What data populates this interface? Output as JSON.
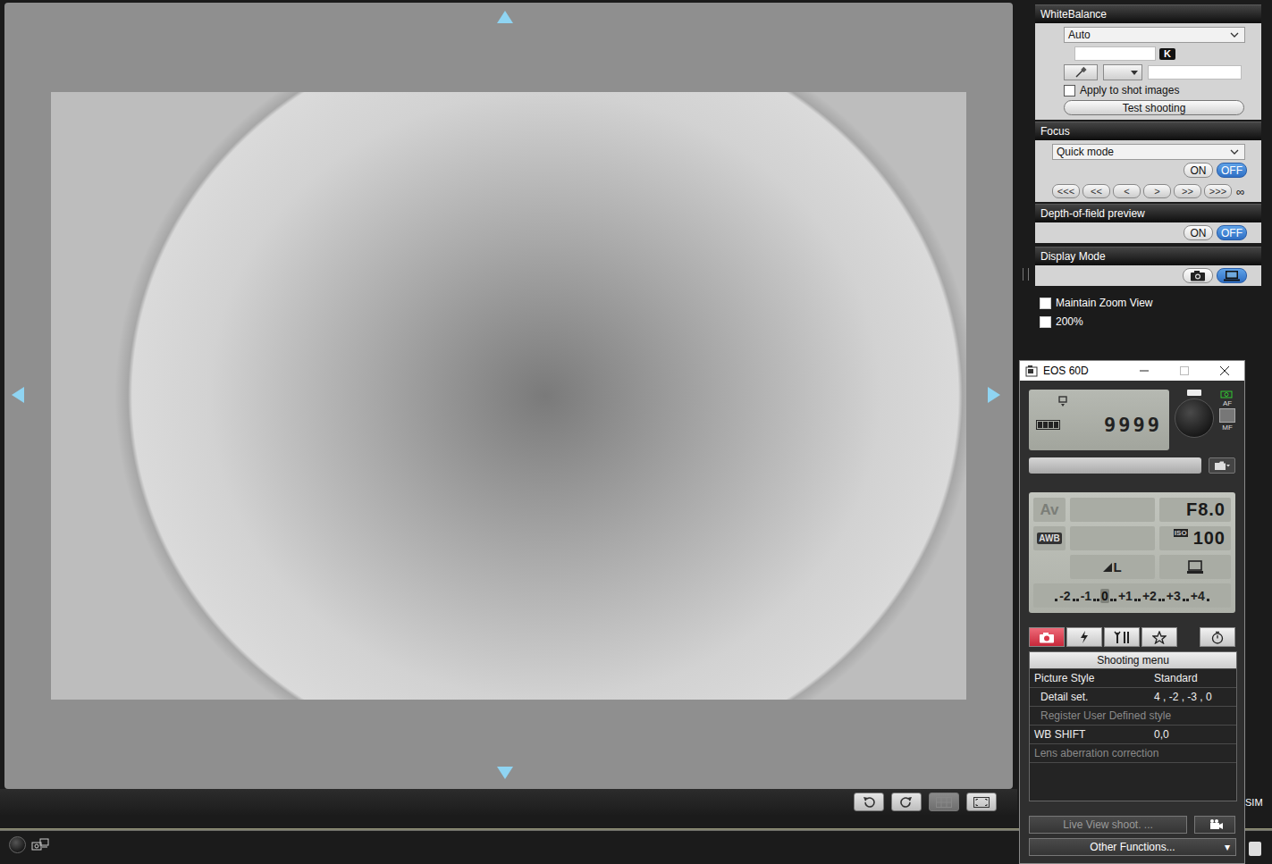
{
  "liveView": {
    "image": "coin-photo"
  },
  "whiteBalance": {
    "title": "WhiteBalance",
    "mode": "Auto",
    "kelvinValue": "",
    "kelvinUnit": "K",
    "customValue": "",
    "applyToShot": {
      "label": "Apply to shot images",
      "checked": false
    },
    "testButton": "Test shooting"
  },
  "focus": {
    "title": "Focus",
    "mode": "Quick mode",
    "toggle": [
      {
        "label": "ON",
        "selected": false
      },
      {
        "label": "OFF",
        "selected": true
      }
    ],
    "steps": [
      "<<<",
      "<<",
      "<",
      ">",
      ">>",
      ">>>"
    ],
    "infinity": "∞"
  },
  "depthOfField": {
    "title": "Depth-of-field preview",
    "toggle": [
      {
        "label": "ON",
        "selected": false
      },
      {
        "label": "OFF",
        "selected": true
      }
    ]
  },
  "displayMode": {
    "title": "Display Mode",
    "options": [
      {
        "kind": "camera",
        "selected": false
      },
      {
        "kind": "computer",
        "selected": true
      }
    ]
  },
  "checkboxes": [
    {
      "label": "Maintain Zoom View",
      "checked": false
    },
    {
      "label": "200%",
      "checked": false
    }
  ],
  "sideLabel": "SIM",
  "cameraWindow": {
    "title": "EOS 60D",
    "shots": "9999",
    "battery": {
      "level": 1
    },
    "afmf": [
      "AF",
      "MF"
    ],
    "mode": "Av",
    "aperture": "F8.0",
    "wb": "AWB",
    "isoLabel": "ISO",
    "iso": "100",
    "quality": "L",
    "exposure": [
      {
        "label": "-2",
        "selected": false
      },
      {
        "label": "-1",
        "selected": false
      },
      {
        "label": "0",
        "selected": true
      },
      {
        "label": "+1",
        "selected": false
      },
      {
        "label": "+2",
        "selected": false
      },
      {
        "label": "+3",
        "selected": false
      },
      {
        "label": "+4",
        "selected": false
      }
    ],
    "tabs": [
      {
        "kind": "shoot",
        "selected": true
      },
      {
        "kind": "flash",
        "selected": false
      },
      {
        "kind": "setup",
        "selected": false
      },
      {
        "kind": "mymenu",
        "selected": false
      }
    ],
    "menu": {
      "title": "Shooting menu",
      "rows": [
        {
          "label": "Picture Style",
          "value": "Standard",
          "kind": "item",
          "disabled": false
        },
        {
          "label": "Detail set.",
          "value": "4 , -2 , -3 , 0",
          "kind": "sub",
          "disabled": false
        },
        {
          "label": "Register User Defined style",
          "value": "",
          "kind": "sub",
          "disabled": true
        },
        {
          "label": "WB SHIFT",
          "value": "0,0",
          "kind": "item",
          "disabled": false
        },
        {
          "label": "Lens aberration correction",
          "value": "",
          "kind": "item",
          "disabled": true
        }
      ]
    },
    "liveViewButton": {
      "label": "Live View shoot. ...",
      "disabled": true
    },
    "otherFunctions": {
      "label": "Other Functions...",
      "arrow": "▾"
    }
  }
}
